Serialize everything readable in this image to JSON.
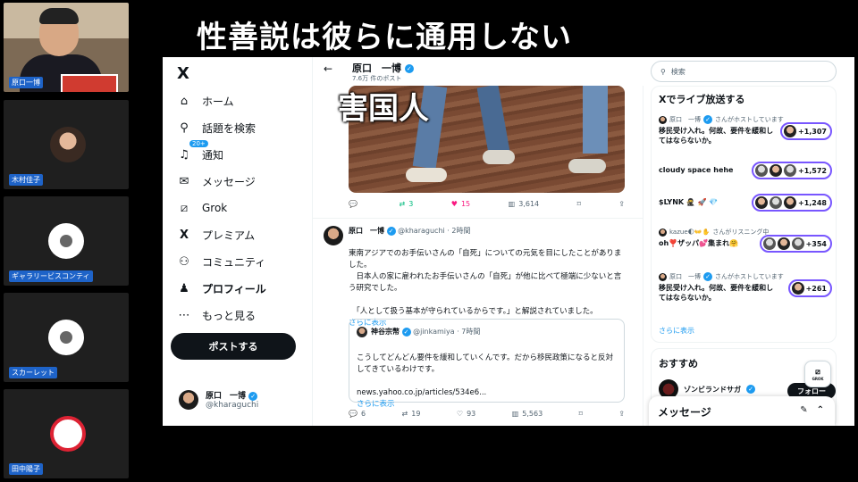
{
  "caption": "性善説は彼らに通用しない",
  "participants": [
    {
      "name": "原口一博"
    },
    {
      "name": "木村佳子"
    },
    {
      "name": "ギャラリービスコンティ"
    },
    {
      "name": "スカーレット"
    },
    {
      "name": "田中陽子"
    }
  ],
  "nav": {
    "logo": "X",
    "items": [
      {
        "icon": "home-icon",
        "glyph": "⌂",
        "label": "ホーム"
      },
      {
        "icon": "search-icon",
        "glyph": "⚲",
        "label": "話題を検索"
      },
      {
        "icon": "bell-icon",
        "glyph": "♫",
        "label": "通知",
        "badge": "20+"
      },
      {
        "icon": "mail-icon",
        "glyph": "✉",
        "label": "メッセージ"
      },
      {
        "icon": "grok-icon",
        "glyph": "⧄",
        "label": "Grok"
      },
      {
        "icon": "x-premium-icon",
        "glyph": "X",
        "label": "プレミアム"
      },
      {
        "icon": "community-icon",
        "glyph": "⚇",
        "label": "コミュニティ"
      },
      {
        "icon": "profile-icon",
        "glyph": "♟",
        "label": "プロフィール"
      },
      {
        "icon": "more-icon",
        "glyph": "⋯",
        "label": "もっと見る"
      }
    ],
    "post_button": "ポストする",
    "account": {
      "name": "原口　一博",
      "handle": "@kharaguchi"
    }
  },
  "feed": {
    "header_name": "原口　一博",
    "header_sub": "7.6万 件のポスト",
    "media_overlay": "害国人",
    "media_actions": {
      "replies": "",
      "reposts": "3",
      "likes": "15",
      "views": "3,614"
    },
    "tweet": {
      "name": "原口　一博",
      "handle": "@kharaguchi",
      "time": "· 2時間",
      "body": "東南アジアでのお手伝いさんの「自死」についての元気を目にしたことがありました。\n　日本人の家に雇われたお手伝いさんの「自死」が他に比べて極端に少ないと言う研究でした。\n\n　「人として扱う基本が守られているからです。」と解説されていました。",
      "show_more": "さらに表示",
      "quote": {
        "name": "神谷宗幣",
        "handle": "@jinkamiya",
        "time": "· 7時間",
        "body": "こうしてどんどん要件を緩和していくんです。だから移民政策になると反対してきているわけです。\n\nnews.yahoo.co.jp/articles/534e6...",
        "show_more": "さらに表示"
      },
      "actions": {
        "replies": "6",
        "reposts": "19",
        "likes": "93",
        "views": "5,563"
      }
    }
  },
  "right": {
    "search_placeholder": "検索",
    "live_title": "Xでライブ放送する",
    "live_items": [
      {
        "host": "原口　一博",
        "host_suffix": "さんがホストしています",
        "title": "移民受け入れ。何故、要件を緩和してはならないか。",
        "count": "+1,307"
      },
      {
        "host": "",
        "host_suffix": "",
        "title": "cloudy space hehe",
        "count": "+1,572"
      },
      {
        "host": "",
        "host_suffix": "",
        "title": "$LYNK 🥷 🚀 💎",
        "count": "+1,248"
      },
      {
        "host": "kazue🌓👐✋",
        "host_suffix": "さんがリスニング中",
        "title": "oh❣️ザッパ💕集まれ🤗",
        "count": "+354"
      },
      {
        "host": "原口　一博",
        "host_suffix": "さんがホストしています",
        "title": "移民受け入れ。何故、要件を緩和してはならないか。",
        "count": "+261"
      }
    ],
    "show_more": "さらに表示",
    "recommend_title": "おすすめ",
    "recommend_name": "ゾンビランドサガ",
    "follow_label": "フォロー",
    "grok_label": "GROK",
    "messages_label": "メッセージ"
  }
}
